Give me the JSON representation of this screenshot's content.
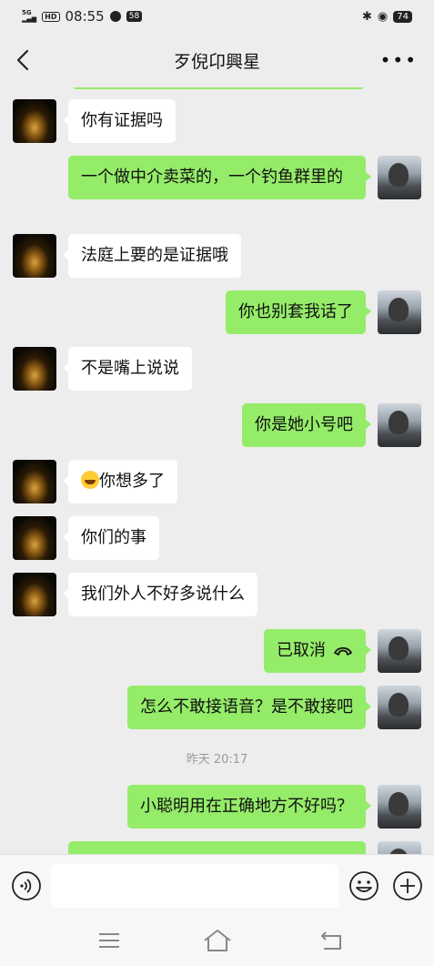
{
  "status_bar": {
    "network": "5G",
    "hd": "HD",
    "time": "08:55",
    "notification_count": "58",
    "battery": "74"
  },
  "header": {
    "title": "歹倪卬興星"
  },
  "messages": [
    {
      "from": "them",
      "text": "你有证据吗"
    },
    {
      "from": "me",
      "text": "一个做中介卖菜的，一个钓鱼群里的"
    },
    {
      "from": "them",
      "text": "法庭上要的是证据哦"
    },
    {
      "from": "me",
      "text": "你也别套我话了"
    },
    {
      "from": "them",
      "text": "不是嘴上说说"
    },
    {
      "from": "me",
      "text": "你是她小号吧"
    },
    {
      "from": "them",
      "text": "你想多了",
      "emoji": "laughing-tears-emoji"
    },
    {
      "from": "them",
      "text": "你们的事"
    },
    {
      "from": "them",
      "text": "我们外人不好多说什么"
    },
    {
      "from": "me",
      "text": "已取消",
      "icon": "call-cancelled-icon"
    },
    {
      "from": "me",
      "text": "怎么不敢接语音？是不敢接吧"
    },
    {
      "from": "me",
      "text": "小聪明用在正确地方不好吗？"
    }
  ],
  "timestamp": "昨天 20:17",
  "input_bar": {
    "placeholder": "",
    "icons": [
      "voice-icon",
      "emoji-icon",
      "plus-icon"
    ]
  },
  "nav_bar": {
    "icons": [
      "menu-icon",
      "home-icon",
      "back-icon"
    ]
  }
}
